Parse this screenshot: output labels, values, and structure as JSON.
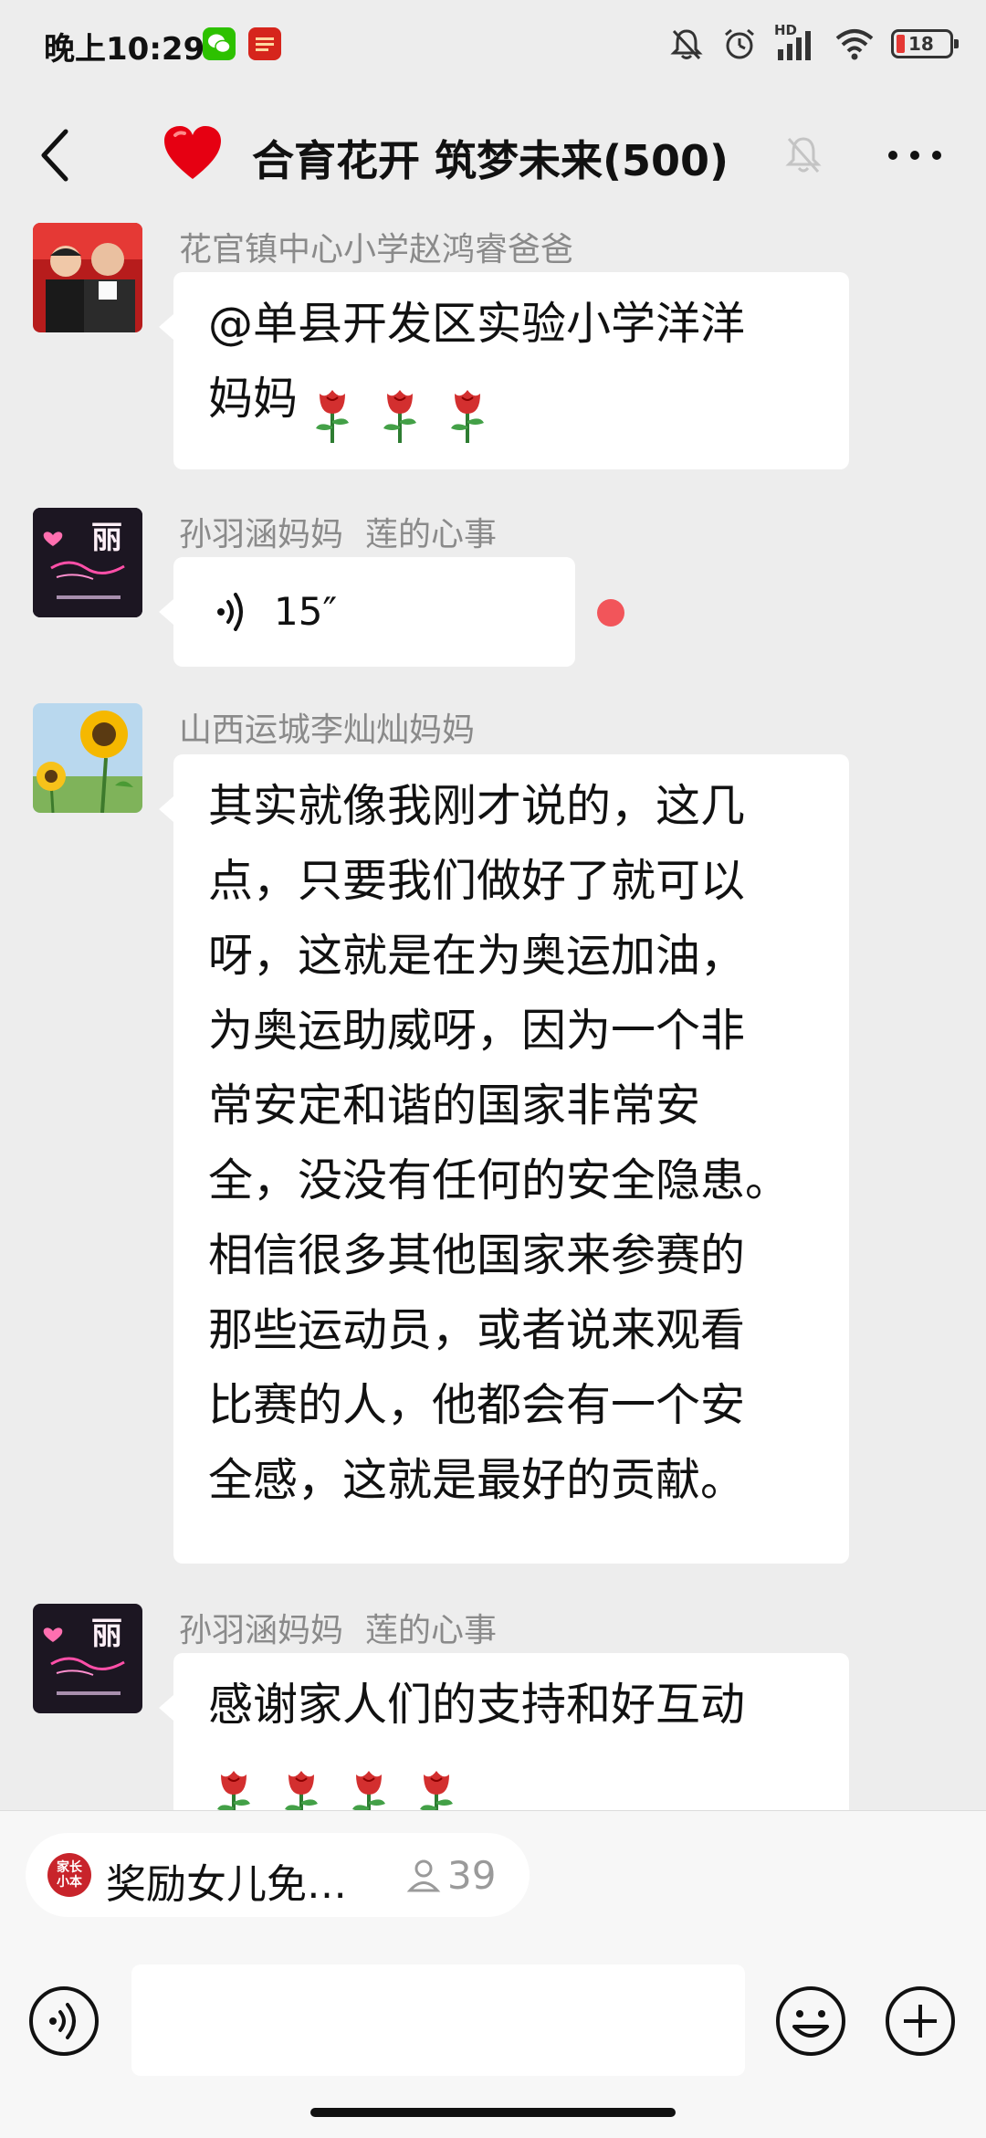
{
  "status_bar": {
    "time": "晚上10:29",
    "hd_label": "HD",
    "battery_level": "18",
    "icons": [
      "wechat-icon",
      "xuexi-app-icon",
      "alarm-muted-icon",
      "alarm-clock-icon",
      "signal-icon",
      "wifi-icon",
      "battery-icon"
    ]
  },
  "header": {
    "title": "合育花开 筑梦未来(500)",
    "icons": [
      "back-arrow-icon",
      "heart-icon",
      "muted-bell-icon",
      "more-dots-icon"
    ]
  },
  "messages": [
    {
      "sender": "花官镇中心小学赵鸿睿爸爸",
      "type": "text",
      "text": "@单县开发区实验小学洋洋\n妈妈",
      "emoji": "rose",
      "emoji_count": 3
    },
    {
      "sender": "孙羽涵妈妈",
      "sender_tag": "莲的心事",
      "type": "voice",
      "duration": "15″",
      "unread": true
    },
    {
      "sender": "山西运城李灿灿妈妈",
      "type": "text",
      "text": "其实就像我刚才说的，这几\n点，只要我们做好了就可以\n呀，这就是在为奥运加油，\n为奥运助威呀，因为一个非\n常安定和谐的国家非常安\n全，没没有任何的安全隐患。\n相信很多其他国家来参赛的\n那些运动员，或者说来观看\n比赛的人，他都会有一个安\n全感，这就是最好的贡献。"
    },
    {
      "sender": "孙羽涵妈妈",
      "sender_tag": "莲的心事",
      "type": "text",
      "text": "感谢家人们的支持和好互动",
      "emoji": "rose",
      "emoji_count": 4
    }
  ],
  "avatar_text": {
    "li_label": "丽"
  },
  "bottom": {
    "app_logo_text": "家长\n小本",
    "app_title": "奖励女儿免…",
    "viewer_count": "39",
    "input_value": "",
    "icons": [
      "voice-toggle-icon",
      "emoji-icon",
      "plus-icon"
    ]
  },
  "colors": {
    "background": "#ededed",
    "bubble": "#ffffff",
    "sender_text": "#8a8a8a",
    "unread_dot": "#f2555a",
    "heart": "#e60012",
    "battery_low": "#e53935"
  }
}
